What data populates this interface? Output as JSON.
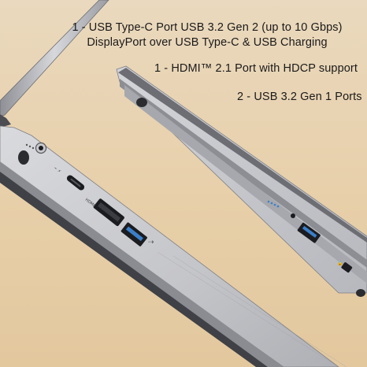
{
  "specs": {
    "usb_c_line1": "1 - USB Type-C Port USB 3.2 Gen 2 (up to 10 Gbps)",
    "usb_c_line2": "DisplayPort over USB Type-C  & USB Charging",
    "hdmi": "1 - HDMI™ 2.1 Port with HDCP support",
    "usb_a": "2 - USB 3.2 Gen 1 Ports"
  },
  "colors": {
    "background": "#e9d5b5",
    "laptop_silver": "#c8c9cd",
    "laptop_dark_edge": "#5a5c62",
    "port_black": "#1b1c20",
    "text": "#1a1a1a",
    "usb_blue": "#3b7fc9"
  },
  "port_labels": {
    "hdmi_label": "HDMI"
  }
}
